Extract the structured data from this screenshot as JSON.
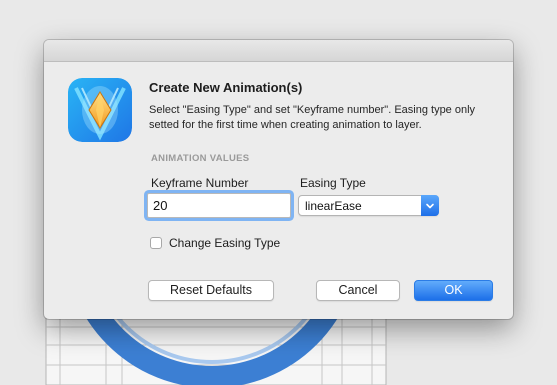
{
  "dialog": {
    "title": "Create New Animation(s)",
    "description": "Select \"Easing Type\" and set \"Keyframe number\". Easing type only setted for the first time when creating animation to layer.",
    "section_label": "ANIMATION VALUES",
    "keyframe": {
      "label": "Keyframe Number",
      "value": "20"
    },
    "easing": {
      "label": "Easing Type",
      "selected": "linearEase"
    },
    "checkbox": {
      "label": "Change Easing Type",
      "checked": false
    },
    "buttons": {
      "reset": "Reset Defaults",
      "cancel": "Cancel",
      "ok": "OK"
    }
  },
  "colors": {
    "accent": "#1f70e9",
    "focus_ring": "#7fb4f3",
    "background_ring": "#3c7fd3"
  }
}
